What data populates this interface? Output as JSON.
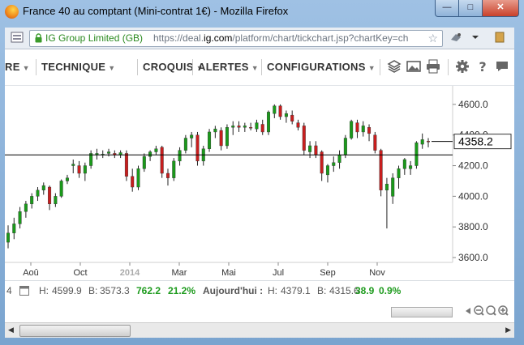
{
  "window": {
    "title": "France 40 au comptant (Mini-contrat 1€) - Mozilla Firefox",
    "minimize_label": "—",
    "maximize_label": "□",
    "close_label": "✕"
  },
  "browser": {
    "site_identity": "IG Group Limited (GB)",
    "url_prefix": "https://deal.",
    "url_domain": "ig.com",
    "url_path": "/platform/chart/tickchart.jsp?chartKey=ch"
  },
  "toolbar": {
    "menus": [
      {
        "label": "RE"
      },
      {
        "label": "TECHNIQUE"
      },
      {
        "label": "CROQUIS"
      },
      {
        "label": "ALERTES"
      },
      {
        "label": "CONFIGURATIONS"
      }
    ],
    "icons": [
      "layers-icon",
      "image-icon",
      "print-icon",
      "gear-icon",
      "help-icon",
      "comment-icon"
    ]
  },
  "status": {
    "lead": "4",
    "high_label": "H:",
    "high": "4599.9",
    "low_label": "B:",
    "low": "3573.3",
    "range": "762.2",
    "range_pct": "21.2%",
    "today_label": "Aujourd'hui :",
    "today_high_label": "H:",
    "today_high": "4379.1",
    "today_low_label": "B:",
    "today_low": "4315.6",
    "today_change": "38.9",
    "today_pct": "0.9%"
  },
  "colors": {
    "up": "#1a9a1a",
    "down": "#c81e1e",
    "wick": "#222222",
    "close_line": "#000000"
  },
  "chart_data": {
    "type": "candlestick",
    "ylim": [
      3600,
      4700
    ],
    "yticks": [
      "4600.0",
      "4400.0",
      "4200.0",
      "4000.0",
      "3800.0",
      "3600.0"
    ],
    "xticks": [
      "Aoû",
      "Oct",
      "2014",
      "Mar",
      "Mai",
      "Jul",
      "Sep",
      "Nov"
    ],
    "last_price": "4358.2",
    "last_value": 4358.2,
    "close_line_value": 4270,
    "grid": false,
    "candles": [
      {
        "o": 3700,
        "h": 3810,
        "l": 3660,
        "c": 3760
      },
      {
        "o": 3760,
        "h": 3860,
        "l": 3720,
        "c": 3820
      },
      {
        "o": 3820,
        "h": 3930,
        "l": 3790,
        "c": 3900
      },
      {
        "o": 3900,
        "h": 3970,
        "l": 3860,
        "c": 3950
      },
      {
        "o": 3950,
        "h": 4020,
        "l": 3920,
        "c": 4000
      },
      {
        "o": 4000,
        "h": 4060,
        "l": 3970,
        "c": 4040
      },
      {
        "o": 4040,
        "h": 4090,
        "l": 4010,
        "c": 4070
      },
      {
        "o": 4060,
        "h": 4070,
        "l": 3910,
        "c": 3950
      },
      {
        "o": 3950,
        "h": 4020,
        "l": 3930,
        "c": 4000
      },
      {
        "o": 4000,
        "h": 4110,
        "l": 3990,
        "c": 4100
      },
      {
        "o": 4100,
        "h": 4140,
        "l": 4080,
        "c": 4120
      },
      {
        "o": 4200,
        "h": 4240,
        "l": 4150,
        "c": 4210
      },
      {
        "o": 4200,
        "h": 4230,
        "l": 4120,
        "c": 4150
      },
      {
        "o": 4150,
        "h": 4220,
        "l": 4100,
        "c": 4200
      },
      {
        "o": 4200,
        "h": 4300,
        "l": 4180,
        "c": 4280
      },
      {
        "o": 4270,
        "h": 4310,
        "l": 4240,
        "c": 4280
      },
      {
        "o": 4270,
        "h": 4300,
        "l": 4250,
        "c": 4275
      },
      {
        "o": 4280,
        "h": 4310,
        "l": 4260,
        "c": 4290
      },
      {
        "o": 4280,
        "h": 4300,
        "l": 4250,
        "c": 4270
      },
      {
        "o": 4270,
        "h": 4300,
        "l": 4250,
        "c": 4285
      },
      {
        "o": 4280,
        "h": 4300,
        "l": 4100,
        "c": 4130
      },
      {
        "o": 4130,
        "h": 4180,
        "l": 4030,
        "c": 4060
      },
      {
        "o": 4060,
        "h": 4200,
        "l": 4040,
        "c": 4180
      },
      {
        "o": 4180,
        "h": 4280,
        "l": 4160,
        "c": 4260
      },
      {
        "o": 4260,
        "h": 4300,
        "l": 4230,
        "c": 4290
      },
      {
        "o": 4290,
        "h": 4330,
        "l": 4270,
        "c": 4310
      },
      {
        "o": 4320,
        "h": 4330,
        "l": 4120,
        "c": 4150
      },
      {
        "o": 4150,
        "h": 4180,
        "l": 4070,
        "c": 4120
      },
      {
        "o": 4120,
        "h": 4250,
        "l": 4100,
        "c": 4230
      },
      {
        "o": 4230,
        "h": 4320,
        "l": 4200,
        "c": 4300
      },
      {
        "o": 4300,
        "h": 4400,
        "l": 4280,
        "c": 4380
      },
      {
        "o": 4380,
        "h": 4420,
        "l": 4320,
        "c": 4400
      },
      {
        "o": 4400,
        "h": 4420,
        "l": 4200,
        "c": 4230
      },
      {
        "o": 4230,
        "h": 4330,
        "l": 4200,
        "c": 4310
      },
      {
        "o": 4310,
        "h": 4440,
        "l": 4290,
        "c": 4420
      },
      {
        "o": 4420,
        "h": 4460,
        "l": 4380,
        "c": 4440
      },
      {
        "o": 4430,
        "h": 4450,
        "l": 4300,
        "c": 4330
      },
      {
        "o": 4330,
        "h": 4470,
        "l": 4310,
        "c": 4450
      },
      {
        "o": 4450,
        "h": 4490,
        "l": 4400,
        "c": 4460
      },
      {
        "o": 4460,
        "h": 4490,
        "l": 4420,
        "c": 4450
      },
      {
        "o": 4450,
        "h": 4480,
        "l": 4420,
        "c": 4460
      },
      {
        "o": 4450,
        "h": 4480,
        "l": 4430,
        "c": 4445
      },
      {
        "o": 4440,
        "h": 4500,
        "l": 4420,
        "c": 4480
      },
      {
        "o": 4470,
        "h": 4500,
        "l": 4400,
        "c": 4420
      },
      {
        "o": 4420,
        "h": 4560,
        "l": 4400,
        "c": 4550
      },
      {
        "o": 4540,
        "h": 4600,
        "l": 4510,
        "c": 4590
      },
      {
        "o": 4590,
        "h": 4600,
        "l": 4500,
        "c": 4520
      },
      {
        "o": 4520,
        "h": 4560,
        "l": 4480,
        "c": 4540
      },
      {
        "o": 4530,
        "h": 4560,
        "l": 4470,
        "c": 4490
      },
      {
        "o": 4480,
        "h": 4500,
        "l": 4430,
        "c": 4450
      },
      {
        "o": 4460,
        "h": 4480,
        "l": 4270,
        "c": 4300
      },
      {
        "o": 4290,
        "h": 4360,
        "l": 4250,
        "c": 4330
      },
      {
        "o": 4330,
        "h": 4360,
        "l": 4250,
        "c": 4270
      },
      {
        "o": 4290,
        "h": 4300,
        "l": 4100,
        "c": 4150
      },
      {
        "o": 4140,
        "h": 4210,
        "l": 4090,
        "c": 4200
      },
      {
        "o": 4200,
        "h": 4260,
        "l": 4160,
        "c": 4220
      },
      {
        "o": 4220,
        "h": 4300,
        "l": 4180,
        "c": 4270
      },
      {
        "o": 4270,
        "h": 4400,
        "l": 4250,
        "c": 4380
      },
      {
        "o": 4380,
        "h": 4500,
        "l": 4370,
        "c": 4490
      },
      {
        "o": 4480,
        "h": 4500,
        "l": 4380,
        "c": 4420
      },
      {
        "o": 4420,
        "h": 4490,
        "l": 4390,
        "c": 4460
      },
      {
        "o": 4450,
        "h": 4470,
        "l": 4360,
        "c": 4410
      },
      {
        "o": 4400,
        "h": 4420,
        "l": 4280,
        "c": 4300
      },
      {
        "o": 4300,
        "h": 4310,
        "l": 4000,
        "c": 4040
      },
      {
        "o": 4040,
        "h": 4120,
        "l": 3790,
        "c": 4080
      },
      {
        "o": 4000,
        "h": 4150,
        "l": 3950,
        "c": 4120
      },
      {
        "o": 4120,
        "h": 4200,
        "l": 4050,
        "c": 4180
      },
      {
        "o": 4180,
        "h": 4250,
        "l": 4140,
        "c": 4240
      },
      {
        "o": 4180,
        "h": 4230,
        "l": 4140,
        "c": 4200
      },
      {
        "o": 4200,
        "h": 4360,
        "l": 4180,
        "c": 4350
      },
      {
        "o": 4340,
        "h": 4410,
        "l": 4310,
        "c": 4370
      },
      {
        "o": 4360,
        "h": 4380,
        "l": 4320,
        "c": 4358
      }
    ]
  }
}
